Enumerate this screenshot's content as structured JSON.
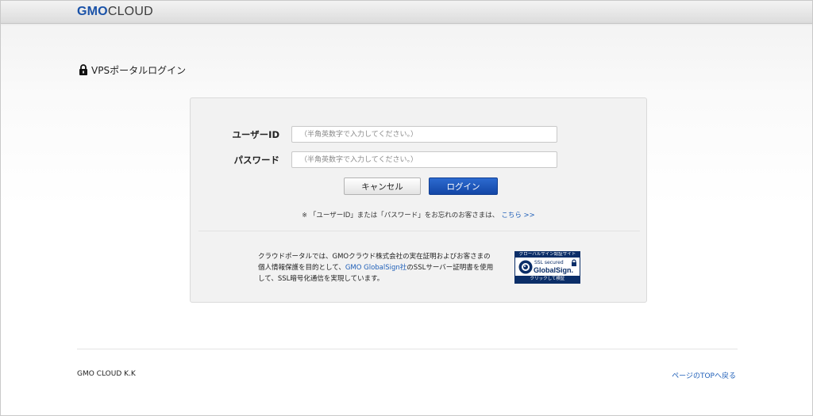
{
  "header": {
    "logo_bold": "GMO",
    "logo_text": "CLOUD"
  },
  "page": {
    "title": "VPSポータルログイン",
    "title_icon": "lock-icon"
  },
  "form": {
    "user_label": "ユーザーID",
    "user_placeholder": "（半角英数字で入力してください。）",
    "user_value": "",
    "pass_label": "パスワード",
    "pass_placeholder": "（半角英数字で入力してください。）",
    "pass_value": "",
    "cancel_label": "キャンセル",
    "login_label": "ログイン",
    "login_color": "#1a52b4"
  },
  "forgot": {
    "mark": "※",
    "text": "「ユーザーID」または「パスワード」をお忘れのお客さまは、",
    "link": "こちら >>"
  },
  "ssl": {
    "line1": "クラウドポータルでは、GMOクラウド株式会社の実在証明およびお客さまの",
    "line2_pre": "個人情報保護を目的として、",
    "line2_link": "GMO GlobalSign社",
    "line2_post": "のSSLサーバー証明書を使用",
    "line3": "して、SSL暗号化通信を実現しています。"
  },
  "seal": {
    "top": "グローバルサイン認証サイト",
    "secured": "SSL secured",
    "brand": "GlobalSign.",
    "bottom": "クリックして検証",
    "color": "#0b2e68"
  },
  "footer": {
    "company": "GMO CLOUD K.K",
    "back_link": "ページのTOPへ戻る"
  }
}
